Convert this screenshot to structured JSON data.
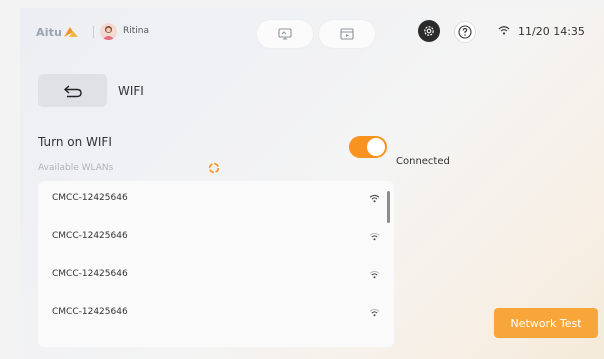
{
  "app": {
    "logo_text": "Aitu"
  },
  "user": {
    "name": "Ritina"
  },
  "status": {
    "time": "11/20 14:35"
  },
  "page": {
    "title": "WIFI"
  },
  "wifi": {
    "toggle_label": "Turn on WIFI",
    "enabled": true,
    "connection_status": "Connected",
    "available_label": "Available WLANs"
  },
  "networks": [
    {
      "name": "CMCC-12425646"
    },
    {
      "name": "CMCC-12425646"
    },
    {
      "name": "CMCC-12425646"
    },
    {
      "name": "CMCC-12425646"
    }
  ],
  "actions": {
    "network_test": "Network Test"
  },
  "colors": {
    "accent": "#f7931e",
    "button": "#f8a63a"
  },
  "icons": [
    "logo-icon",
    "avatar-icon",
    "monitor-icon",
    "video-icon",
    "gear-icon",
    "help-icon",
    "wifi-icon",
    "back-arrow-icon",
    "loading-spinner-icon",
    "wifi-signal-icon"
  ]
}
